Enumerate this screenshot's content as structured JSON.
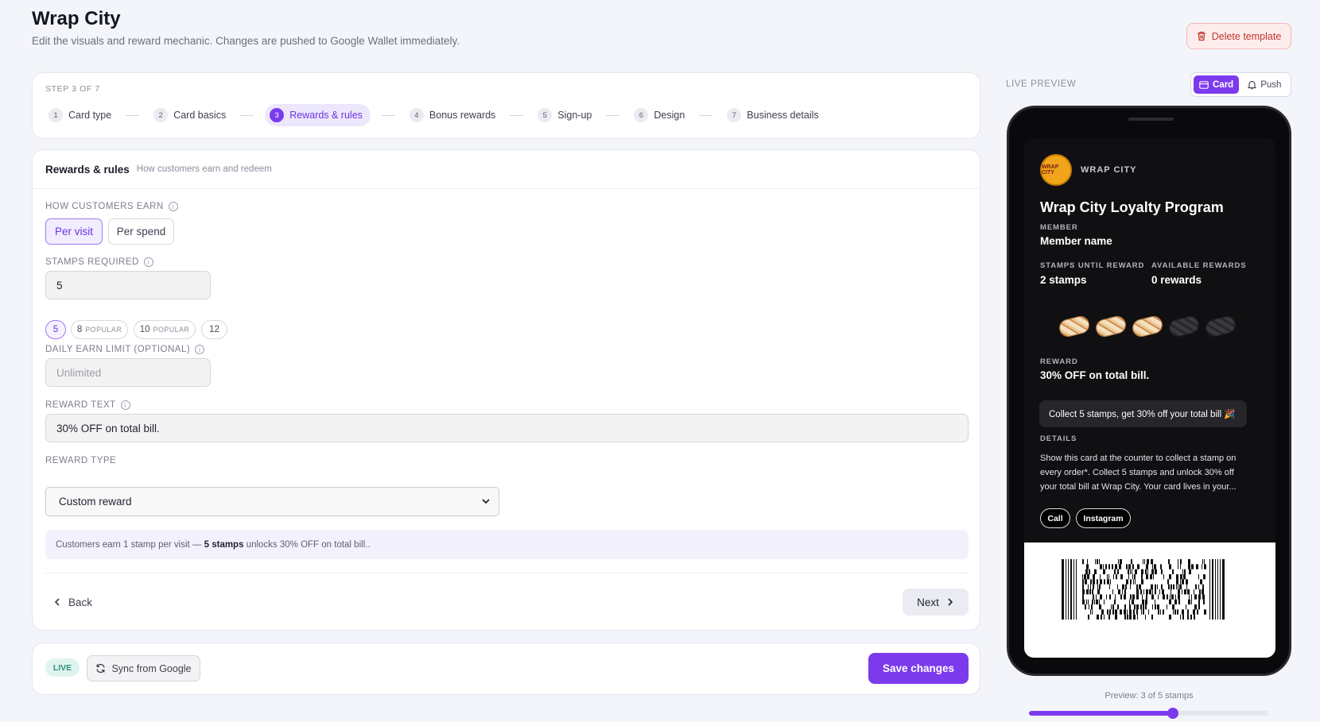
{
  "header": {
    "title": "Wrap City",
    "subtitle": "Edit the visuals and reward mechanic. Changes are pushed to Google Wallet immediately.",
    "delete_label": "Delete template"
  },
  "stepper": {
    "label": "STEP 3 OF 7",
    "steps": [
      {
        "num": "1",
        "label": "Card type"
      },
      {
        "num": "2",
        "label": "Card basics"
      },
      {
        "num": "3",
        "label": "Rewards & rules"
      },
      {
        "num": "4",
        "label": "Bonus rewards"
      },
      {
        "num": "5",
        "label": "Sign-up"
      },
      {
        "num": "6",
        "label": "Design"
      },
      {
        "num": "7",
        "label": "Business details"
      }
    ],
    "active_step": 3
  },
  "form": {
    "title": "Rewards & rules",
    "subtitle": "How customers earn and redeem",
    "earn_label": "HOW CUSTOMERS EARN",
    "earn_options": [
      "Per visit",
      "Per spend"
    ],
    "earn_selected": "Per visit",
    "stamps_label": "STAMPS REQUIRED",
    "stamps_value": "5",
    "stamp_chips": [
      {
        "value": "5",
        "tag": ""
      },
      {
        "value": "8",
        "tag": "POPULAR"
      },
      {
        "value": "10",
        "tag": "POPULAR"
      },
      {
        "value": "12",
        "tag": ""
      }
    ],
    "daily_label": "DAILY EARN LIMIT (OPTIONAL)",
    "daily_placeholder": "Unlimited",
    "reward_text_label": "REWARD TEXT",
    "reward_text_value": "30% OFF on total bill.",
    "reward_type_label": "REWARD TYPE",
    "reward_type_value": "Custom reward",
    "summary_pre": "Customers earn 1 stamp per visit — ",
    "summary_bold": "5 stamps",
    "summary_post": " unlocks 30% OFF on total bill..",
    "back_label": "Back",
    "next_label": "Next"
  },
  "footer": {
    "live_badge": "LIVE",
    "sync_label": "Sync from Google",
    "save_label": "Save changes"
  },
  "preview": {
    "label": "LIVE PREVIEW",
    "toggle_card": "Card",
    "toggle_push": "Push",
    "logo_text": "WRAP CITY",
    "brand": "WRAP CITY",
    "program": "Wrap City Loyalty Program",
    "member_key": "MEMBER",
    "member_value": "Member name",
    "stamps_until_key": "STAMPS UNTIL REWARD",
    "stamps_until_value": "2 stamps",
    "available_key": "AVAILABLE REWARDS",
    "available_value": "0 rewards",
    "stamps_filled": 3,
    "stamps_total": 5,
    "reward_key": "REWARD",
    "reward_value": "30% OFF on total bill.",
    "message": "Collect 5 stamps, get 30% off your total bill 🎉",
    "details_key": "DETAILS",
    "details_text": "Show this card at the counter to collect a stamp on every order*. Collect 5 stamps and unlock 30% off your total bill at Wrap City. Your card lives in your...",
    "links": [
      "Call",
      "Instagram"
    ],
    "caption": "Preview: 3 of 5 stamps",
    "slider_fraction": 0.6
  },
  "colors": {
    "accent": "#7c3aed",
    "page_bg": "#f4f5fa",
    "danger": "#c2362f",
    "live": "#2f8f74"
  }
}
